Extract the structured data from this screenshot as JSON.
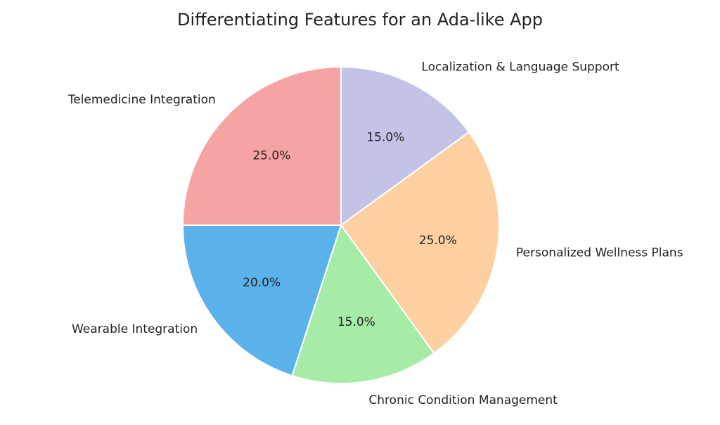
{
  "chart_data": {
    "type": "pie",
    "title": "Differentiating Features for an Ada-like App",
    "slices": [
      {
        "label": "Localization & Language Support",
        "value": 15,
        "pct_text": "15.0%",
        "color": "#c3c3e8"
      },
      {
        "label": "Personalized Wellness Plans",
        "value": 25,
        "pct_text": "25.0%",
        "color": "#fcd0a1"
      },
      {
        "label": "Chronic Condition Management",
        "value": 15,
        "pct_text": "15.0%",
        "color": "#a6eca6"
      },
      {
        "label": "Wearable Integration",
        "value": 20,
        "pct_text": "20.0%",
        "color": "#5bb1ea"
      },
      {
        "label": "Telemedicine Integration",
        "value": 25,
        "pct_text": "25.0%",
        "color": "#f6a3a3"
      }
    ]
  }
}
